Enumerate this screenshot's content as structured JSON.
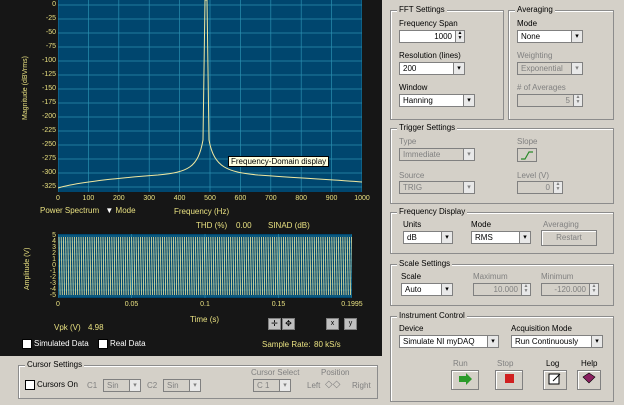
{
  "spectrum": {
    "ylabel": "Magnitude (dBVrms)",
    "yticks": [
      "0",
      "-25",
      "-50",
      "-75",
      "-100",
      "-125",
      "-150",
      "-175",
      "-200",
      "-225",
      "-250",
      "-275",
      "-300",
      "-325"
    ],
    "xticks": [
      "0",
      "100",
      "200",
      "300",
      "400",
      "500",
      "600",
      "700",
      "800",
      "900",
      "1000"
    ],
    "tooltip": "Frequency-Domain display",
    "mode_dropdown": "Power Spectrum",
    "mode_label": "Mode",
    "freq_label": "Frequency (Hz)",
    "thd_label": "THD (%)",
    "thd_value": "0.00",
    "sinad_label": "SINAD (dB)"
  },
  "time": {
    "ylabel": "Amplitude (V)",
    "yticks": [
      "5",
      "4",
      "3",
      "2",
      "1",
      "0",
      "-1",
      "-2",
      "-3",
      "-4",
      "-5"
    ],
    "xticks": [
      "0",
      "0.05",
      "0.1",
      "0.15",
      "0.1995"
    ],
    "xlabel": "Time (s)",
    "vpk_label": "Vpk (V)",
    "vpk_value": "4.98",
    "simulated_label": "Simulated Data",
    "real_label": "Real Data",
    "sample_rate_label": "Sample Rate:",
    "sample_rate_value": "80 kS/s"
  },
  "cursor": {
    "title": "Cursor Settings",
    "cursors_on": "Cursors On",
    "c1": "C1",
    "c1_val": "Sin",
    "c2": "C2",
    "c2_val": "Sin",
    "select_label": "Cursor Select",
    "select_val": "C 1",
    "position_label": "Position",
    "left": "Left",
    "right": "Right"
  },
  "fft": {
    "title": "FFT Settings",
    "span_label": "Frequency Span",
    "span_value": "1000",
    "res_label": "Resolution (lines)",
    "res_value": "200",
    "window_label": "Window",
    "window_value": "Hanning"
  },
  "averaging": {
    "title": "Averaging",
    "mode_label": "Mode",
    "mode_value": "None",
    "weighting_label": "Weighting",
    "weighting_value": "Exponential",
    "num_label": "# of Averages",
    "num_value": "5"
  },
  "trigger": {
    "title": "Trigger Settings",
    "type_label": "Type",
    "type_value": "Immediate",
    "slope_label": "Slope",
    "source_label": "Source",
    "source_value": "TRIG",
    "level_label": "Level (V)",
    "level_value": "0"
  },
  "freqdisp": {
    "title": "Frequency Display",
    "units_label": "Units",
    "units_value": "dB",
    "mode_label": "Mode",
    "mode_value": "RMS",
    "avg_label": "Averaging",
    "restart": "Restart"
  },
  "scale": {
    "title": "Scale Settings",
    "scale_label": "Scale",
    "scale_value": "Auto",
    "max_label": "Maximum",
    "max_value": "10.000",
    "min_label": "Minimum",
    "min_value": "-120.000"
  },
  "instrument": {
    "title": "Instrument Control",
    "device_label": "Device",
    "device_value": "Simulate NI myDAQ",
    "acq_label": "Acquisition Mode",
    "acq_value": "Run Continuously",
    "run": "Run",
    "stop": "Stop",
    "log": "Log",
    "help": "Help"
  },
  "colors": {
    "plot_bg": "#00466e",
    "grid": "#2a8fb0",
    "trace": "#f0e8a0",
    "label": "#e8e080",
    "run": "#2a9a2a",
    "stop": "#d02020"
  }
}
